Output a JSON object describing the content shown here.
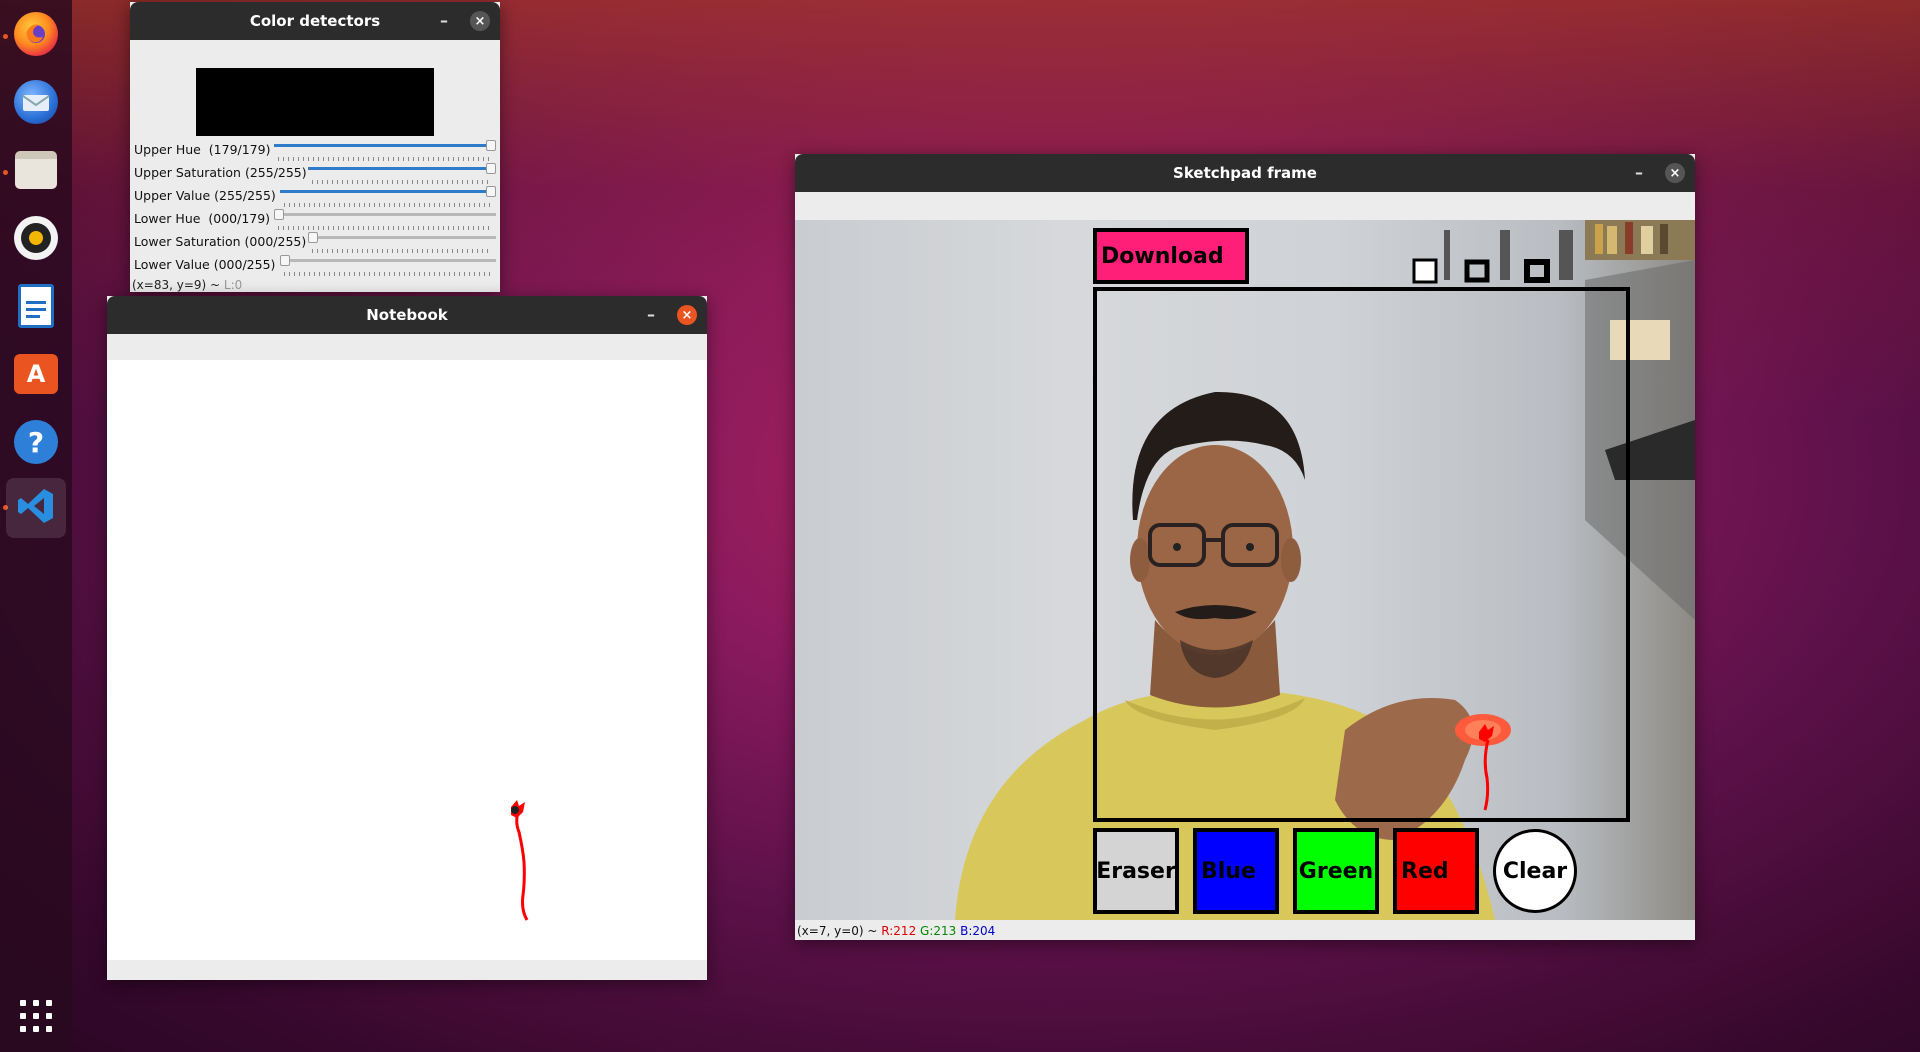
{
  "dock": {
    "items": [
      {
        "name": "firefox-icon"
      },
      {
        "name": "thunderbird-icon"
      },
      {
        "name": "files-icon"
      },
      {
        "name": "rhythmbox-icon"
      },
      {
        "name": "writer-icon"
      },
      {
        "name": "software-icon"
      },
      {
        "name": "help-icon",
        "glyph": "?"
      },
      {
        "name": "vscode-icon"
      }
    ]
  },
  "color_detectors": {
    "title": "Color detectors",
    "minimize": "–",
    "close": "×",
    "sliders": [
      {
        "label": "Upper Hue  (179/179)",
        "value": 179,
        "max": 179
      },
      {
        "label": "Upper Saturation (255/255)",
        "value": 255,
        "max": 255
      },
      {
        "label": "Upper Value (255/255)",
        "value": 255,
        "max": 255
      },
      {
        "label": "Lower Hue  (000/179)",
        "value": 0,
        "max": 179
      },
      {
        "label": "Lower Saturation (000/255)",
        "value": 0,
        "max": 255
      },
      {
        "label": "Lower Value (000/255)",
        "value": 0,
        "max": 255
      }
    ],
    "status": "(x=83, y=9) ~",
    "status_dim": "L:0"
  },
  "notebook": {
    "title": "Notebook",
    "minimize": "–",
    "close": "×"
  },
  "sketchpad": {
    "title": "Sketchpad frame",
    "minimize": "–",
    "close": "×",
    "download_label": "Download",
    "buttons": {
      "eraser": "Eraser",
      "blue": "Blue",
      "green": "Green",
      "red": "Red",
      "clear": "Clear"
    },
    "status_prefix": "(x=7, y=0) ~",
    "status_r": "R:212",
    "status_g": "G:213",
    "status_b": "B:204"
  },
  "colors": {
    "accent_orange": "#e95420",
    "download_pink": "#ff1e78",
    "ink_red": "#ff0000"
  }
}
